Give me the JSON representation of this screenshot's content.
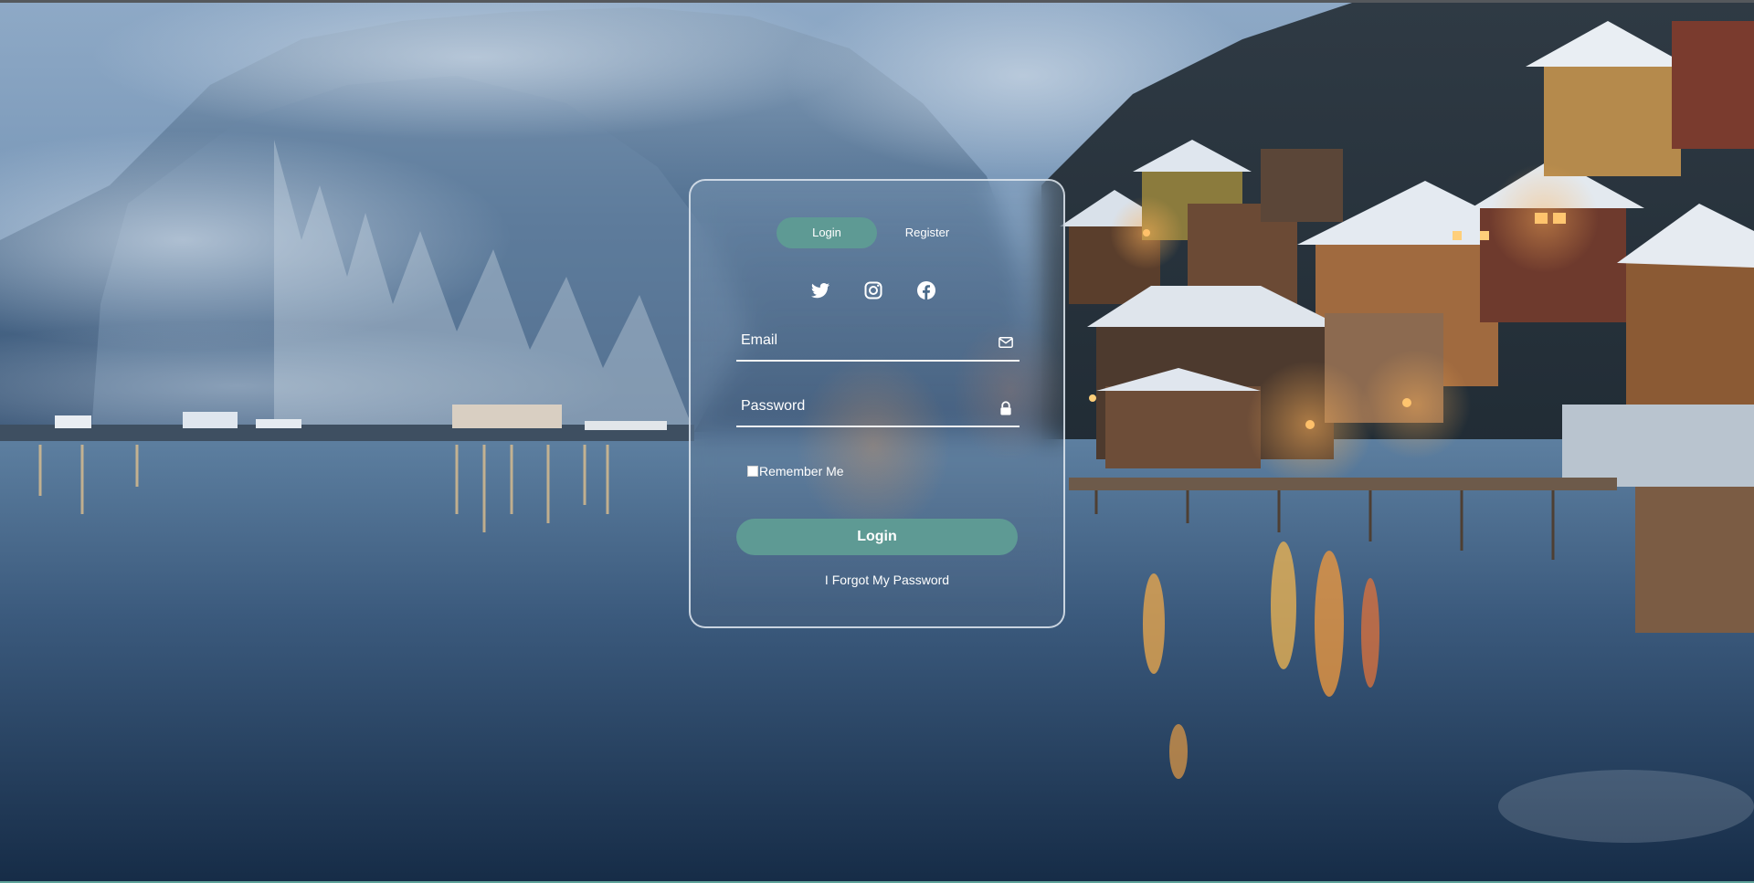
{
  "auth_tabs": {
    "login_label": "Login",
    "register_label": "Register",
    "active": "Login"
  },
  "social_icons": [
    "twitter-icon",
    "instagram-icon",
    "facebook-icon"
  ],
  "form": {
    "email_placeholder": "Email",
    "email_value": "",
    "email_icon": "envelope-icon",
    "password_placeholder": "Password",
    "password_value": "",
    "password_icon": "lock-icon",
    "remember_label": "Remember Me",
    "remember_checked": false,
    "submit_label": "Login",
    "forgot_label": "I Forgot My Password"
  },
  "colors": {
    "accent": "#5e9a94",
    "text": "#ffffff",
    "card_border": "#e1e8f0"
  }
}
